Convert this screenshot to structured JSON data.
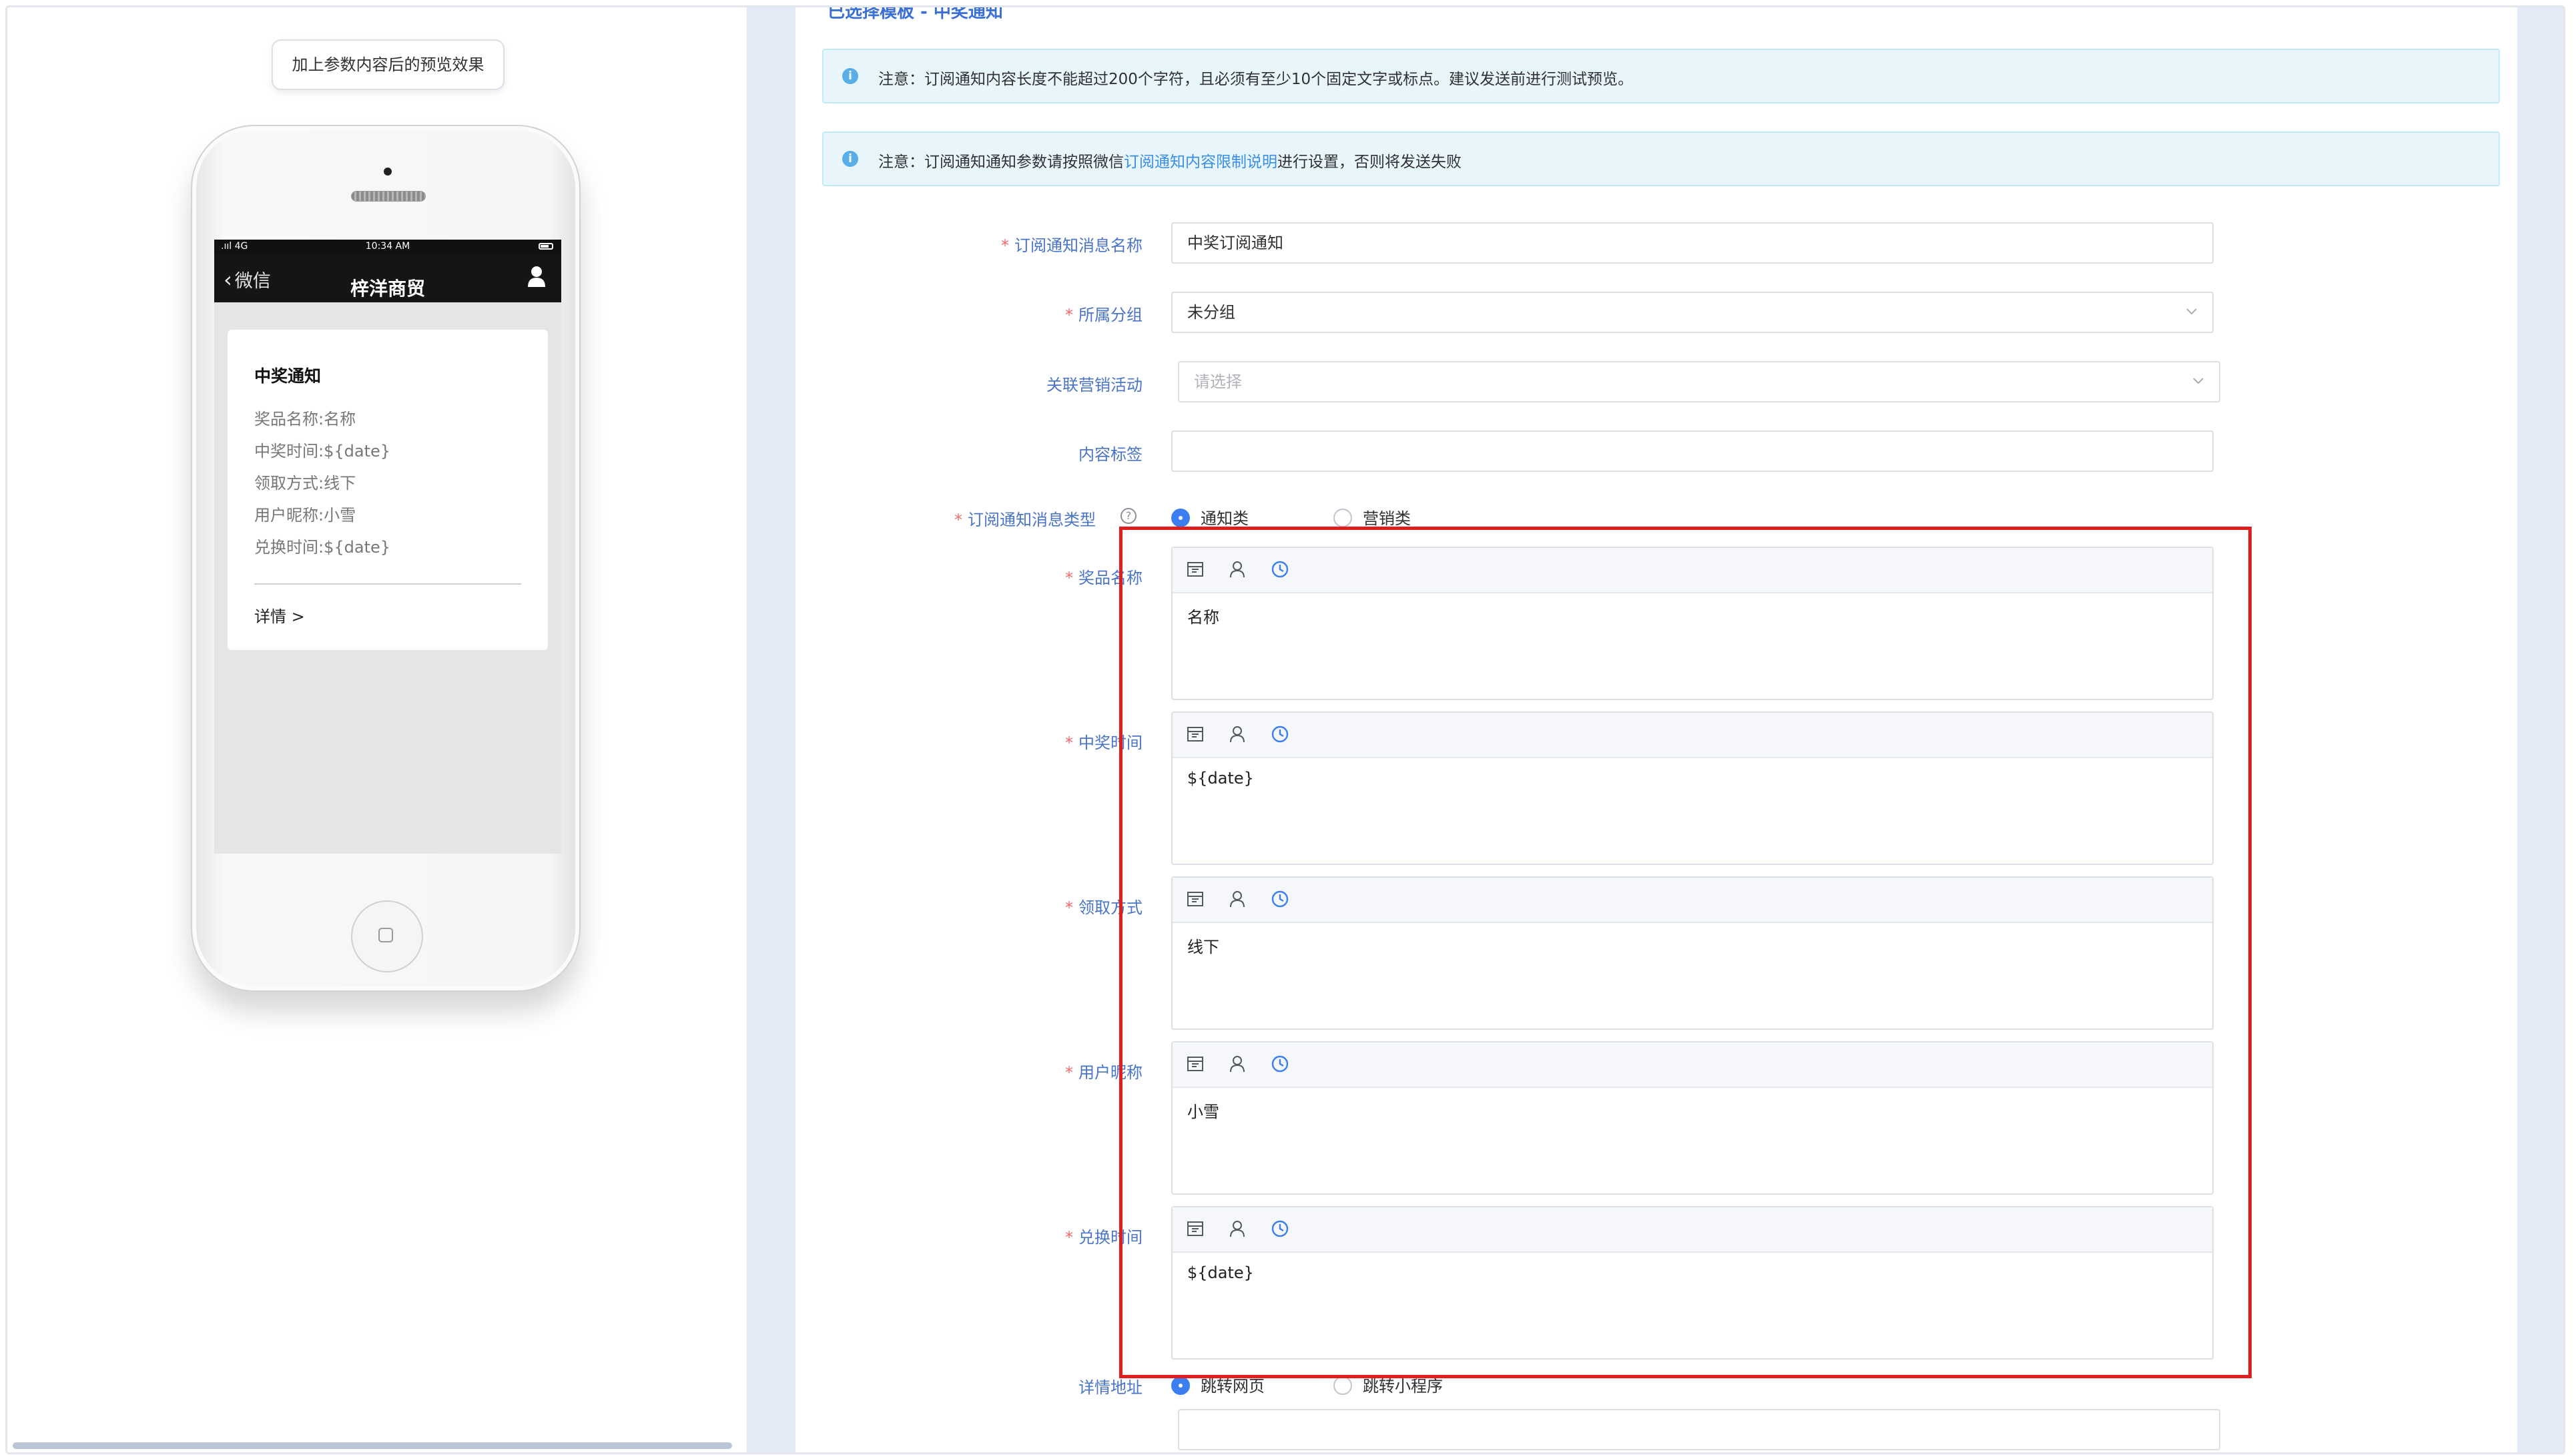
{
  "preview": {
    "tip": "加上参数内容后的预览效果",
    "status_signal": ".ııl 4G",
    "status_time": "10:34 AM",
    "nav_back": "微信",
    "nav_title": "梓洋商贸",
    "message_title": "中奖通知",
    "message_lines": [
      "奖品名称:名称",
      "中奖时间:${date}",
      "领取方式:线下",
      "用户昵称:小雪",
      "兑换时间:${date}"
    ],
    "detail_link": "详情 >"
  },
  "form": {
    "cut_header": "已选择模板 - 中奖通知",
    "alerts": [
      {
        "text": "注意：订阅通知内容长度不能超过200个字符，且必须有至少10个固定文字或标点。建议发送前进行测试预览。"
      },
      {
        "prefix": "注意：订阅通知通知参数请按照微信",
        "link": "订阅通知内容限制说明",
        "suffix": "进行设置，否则将发送失败"
      }
    ],
    "name_label": "订阅通知消息名称",
    "name_value": "中奖订阅通知",
    "group_label": "所属分组",
    "group_value": "未分组",
    "activity_label": "关联营销活动",
    "activity_placeholder": "请选择",
    "tag_label": "内容标签",
    "tag_value": "",
    "type_label": "订阅通知消息类型",
    "type_options": [
      "通知类",
      "营销类"
    ],
    "type_selected": "通知类",
    "fields": [
      {
        "label": "奖品名称",
        "value": "名称"
      },
      {
        "label": "中奖时间",
        "value": "${date}"
      },
      {
        "label": "领取方式",
        "value": "线下"
      },
      {
        "label": "用户昵称",
        "value": "小雪"
      },
      {
        "label": "兑换时间",
        "value": "${date}"
      }
    ],
    "detail_label": "详情地址",
    "detail_options": [
      "跳转网页",
      "跳转小程序"
    ],
    "detail_selected": "跳转网页",
    "detail_url": ""
  },
  "colors": {
    "accent": "#3a7ef0",
    "required": "#f56c6c",
    "highlight_box": "#e01e1e",
    "alert_bg": "#e8f6fc"
  }
}
